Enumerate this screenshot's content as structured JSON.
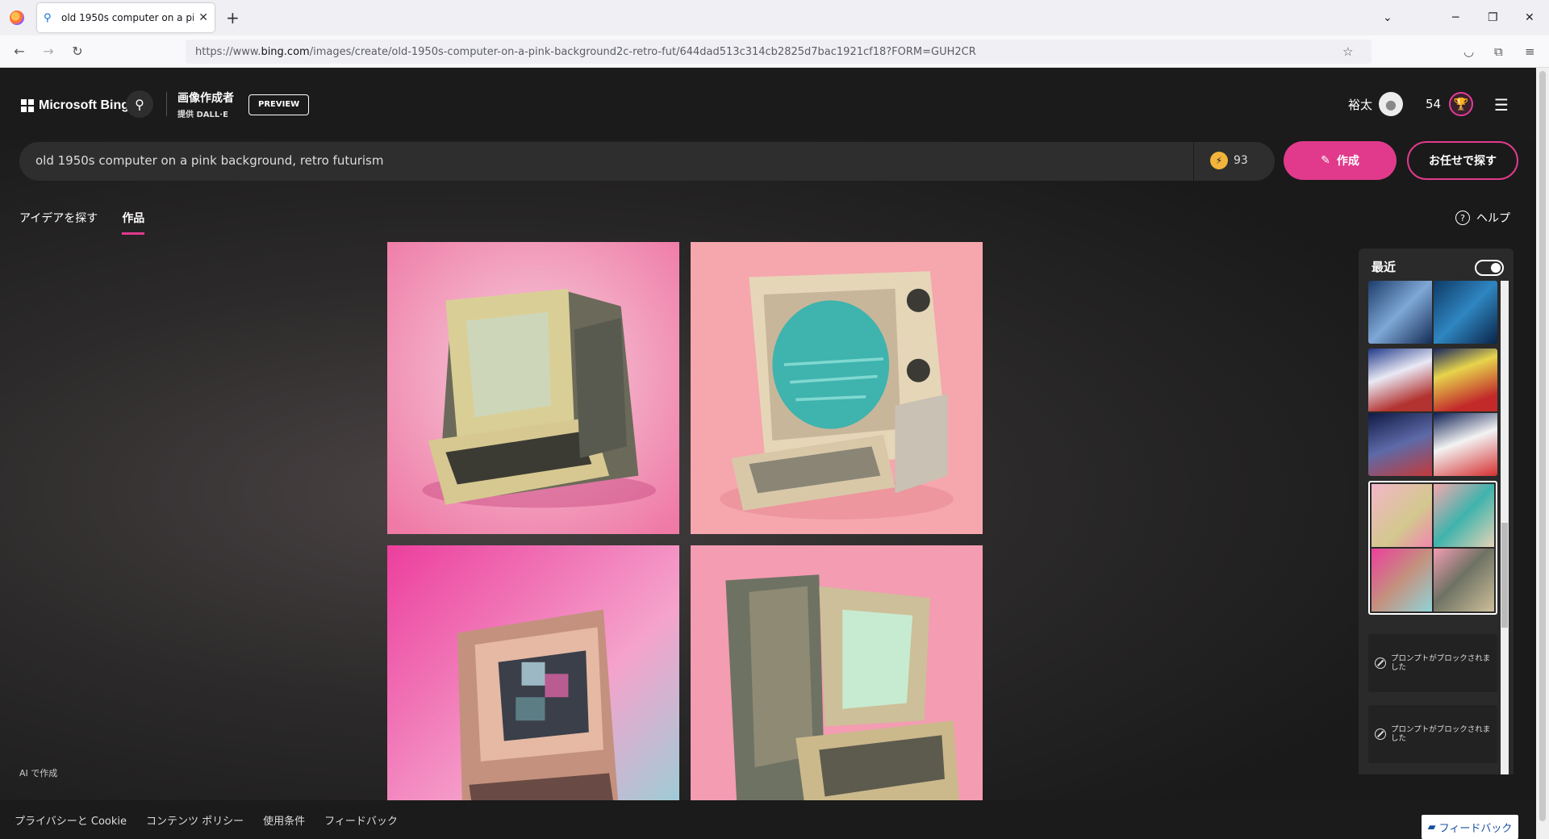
{
  "browser": {
    "tab_title": "old 1950s computer on a pink b",
    "url_prefix": "https://www.",
    "url_host": "bing.com",
    "url_path": "/images/create/old-1950s-computer-on-a-pink-background2c-retro-fut/644dad513c314cb2825d7bac1921cf18?FORM=GUH2CR"
  },
  "header": {
    "logo_text": "Microsoft Bing",
    "creator_title": "画像作成者",
    "creator_sub": "提供 DALL·E",
    "preview_label": "PREVIEW",
    "user_name": "裕太",
    "points": "54"
  },
  "prompt": {
    "text": "old 1950s computer on a pink background, retro futurism",
    "boosts": "93",
    "create_label": "作成",
    "surprise_label": "お任せで探す"
  },
  "tabs": [
    {
      "label": "アイデアを探す"
    },
    {
      "label": "作品"
    }
  ],
  "help_label": "ヘルプ",
  "made_by_ai": "AI で作成",
  "recent": {
    "title": "最近",
    "blocked": [
      {
        "text": "プロンプトがブロックされました"
      },
      {
        "text": "プロンプトがブロックされました"
      }
    ]
  },
  "footer": {
    "links": [
      {
        "label": "プライバシーと Cookie"
      },
      {
        "label": "コンテンツ ポリシー"
      },
      {
        "label": "使用条件"
      },
      {
        "label": "フィードバック"
      }
    ],
    "feedback_button": "フィードバック"
  },
  "colors": {
    "accent": "#e13a8c",
    "bolt": "#f2b43b"
  }
}
